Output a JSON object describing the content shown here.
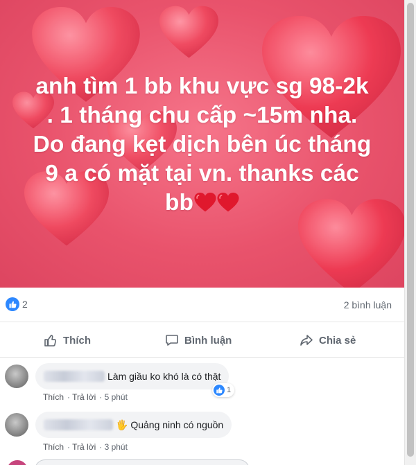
{
  "post": {
    "banner_lines": [
      "anh tìm 1 bb khu vực sg 98-2k",
      ". 1 tháng chu cấp ~15m nha.",
      "Do đang kẹt dịch bên úc tháng",
      "9 a có mặt tại vn. thanks các",
      "bb"
    ],
    "banner_colors": {
      "background": "#e9536c",
      "heart": "#ee3a52",
      "text": "#ffffff"
    }
  },
  "reactions": {
    "like_count": "2",
    "comment_count": "2 bình luận"
  },
  "actions": {
    "like_label": "Thích",
    "comment_label": "Bình luận",
    "share_label": "Chia sẻ"
  },
  "comments": [
    {
      "text": "Làm giầu ko khó là có thật",
      "like_label": "Thích",
      "reply_label": "Trả lời",
      "time": "5 phút",
      "reaction_count": "1"
    },
    {
      "text": "🖐 Quảng ninh có nguồn",
      "like_label": "Thích",
      "reply_label": "Trả lời",
      "time": "3 phút"
    }
  ],
  "icons": [
    "like-reaction-icon",
    "thumbs-up-icon",
    "comment-icon",
    "share-icon",
    "heart-emoji-icon"
  ]
}
